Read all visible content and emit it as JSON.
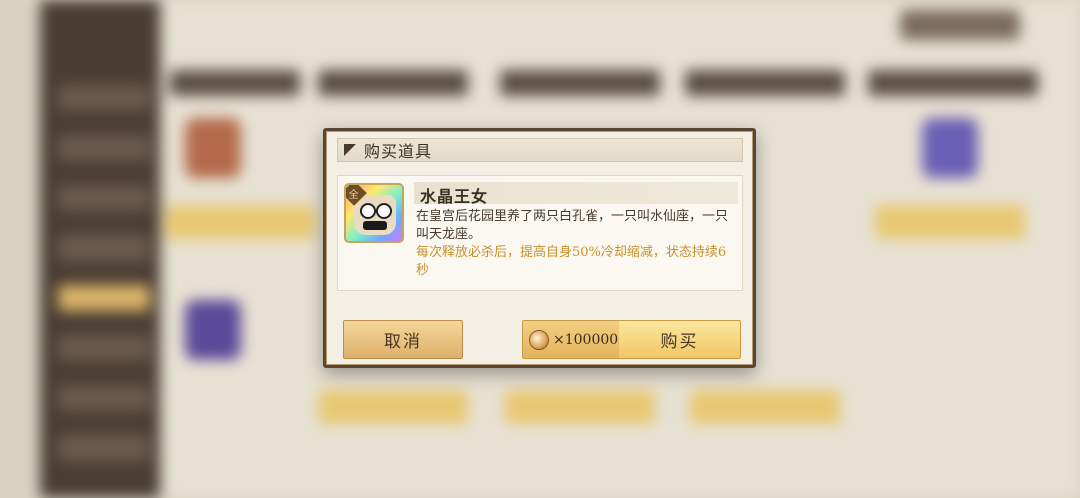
{
  "dialog": {
    "title": "购买道具",
    "item": {
      "name": "水晶王女",
      "badge": "全",
      "description": "在皇宫后花园里养了两只白孔雀，一只叫水仙座，一只叫天龙座。",
      "effect": "每次释放必杀后，提高自身50%冷却缩减，状态持续6秒",
      "icon": "crystal-princess-portrait"
    },
    "buttons": {
      "cancel_label": "取消",
      "price": "×100000",
      "currency_icon": "coin-icon",
      "buy_label": "购买"
    }
  },
  "colors": {
    "frame": "#5a4535",
    "effect_text": "#c9902a",
    "button_gold": "#f1c766"
  }
}
